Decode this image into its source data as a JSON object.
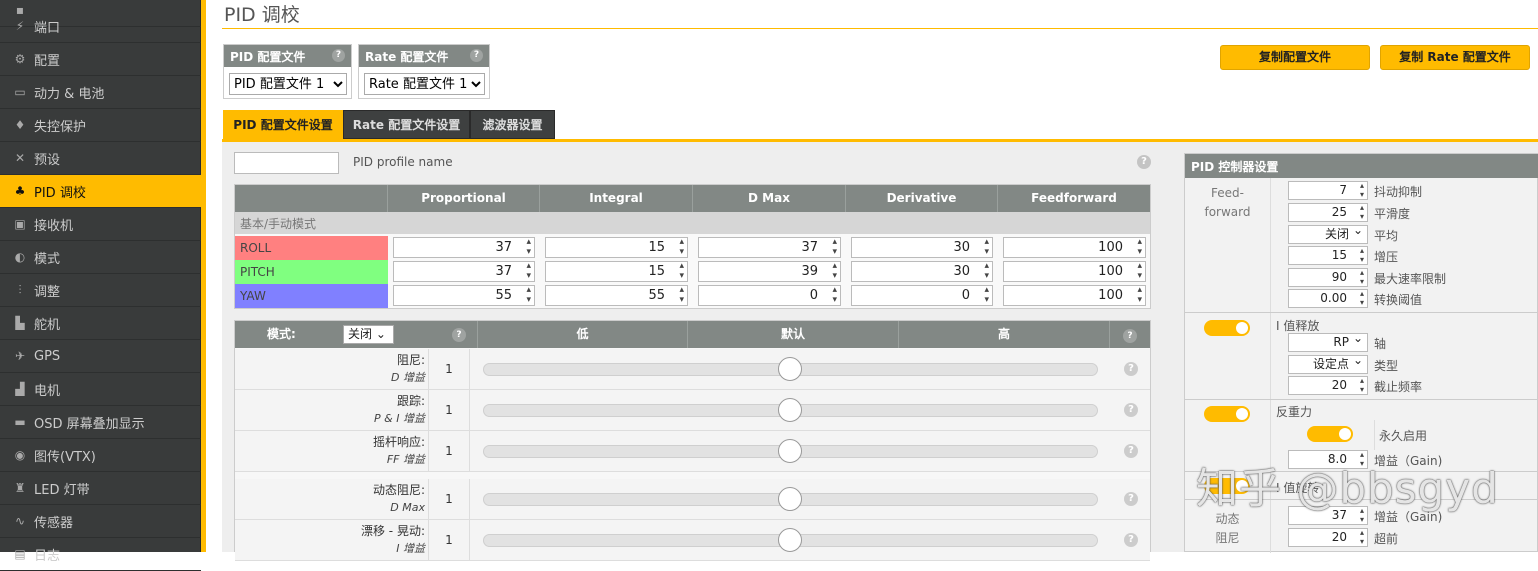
{
  "sidebar": {
    "items": [
      {
        "label": "端口",
        "icon": "plug-icon"
      },
      {
        "label": "配置",
        "icon": "gear-icon"
      },
      {
        "label": "动力 & 电池",
        "icon": "battery-icon"
      },
      {
        "label": "失控保护",
        "icon": "parachute-icon"
      },
      {
        "label": "预设",
        "icon": "wand-icon"
      },
      {
        "label": "PID 调校",
        "icon": "sitemap-icon",
        "active": true
      },
      {
        "label": "接收机",
        "icon": "receiver-icon"
      },
      {
        "label": "模式",
        "icon": "switch-icon"
      },
      {
        "label": "调整",
        "icon": "sliders-icon"
      },
      {
        "label": "舵机",
        "icon": "servo-icon"
      },
      {
        "label": "GPS",
        "icon": "satellite-icon"
      },
      {
        "label": "电机",
        "icon": "motor-icon"
      },
      {
        "label": "OSD 屏幕叠加显示",
        "icon": "osd-icon"
      },
      {
        "label": "图传(VTX)",
        "icon": "broadcast-icon"
      },
      {
        "label": "LED 灯带",
        "icon": "led-icon"
      },
      {
        "label": "传感器",
        "icon": "pulse-icon"
      },
      {
        "label": "日志",
        "icon": "log-icon"
      }
    ]
  },
  "header": {
    "title": "PID 调校"
  },
  "profiles": {
    "pid": {
      "title": "PID 配置文件",
      "selected": "PID 配置文件 1"
    },
    "rate": {
      "title": "Rate 配置文件",
      "selected": "Rate 配置文件 1"
    },
    "copy_pid": "复制配置文件",
    "copy_rate": "复制 Rate 配置文件"
  },
  "tabs": [
    "PID 配置文件设置",
    "Rate 配置文件设置",
    "滤波器设置"
  ],
  "profile_name_label": "PID profile name",
  "pid_table": {
    "columns": [
      "Proportional",
      "Integral",
      "D Max",
      "Derivative",
      "Feedforward"
    ],
    "section": "基本/手动模式",
    "rows": [
      {
        "axis": "ROLL",
        "color": "#ff8080",
        "values": [
          "37",
          "15",
          "37",
          "30",
          "100"
        ]
      },
      {
        "axis": "PITCH",
        "color": "#80ff80",
        "values": [
          "37",
          "15",
          "39",
          "30",
          "100"
        ]
      },
      {
        "axis": "YAW",
        "color": "#8080ff",
        "values": [
          "55",
          "55",
          "0",
          "0",
          "100"
        ]
      }
    ]
  },
  "sliders": {
    "mode_label": "模式:",
    "mode_value": "关闭",
    "low": "低",
    "default": "默认",
    "high": "高",
    "rows": [
      {
        "label": "阻尼:",
        "sub": "D 增益",
        "value": "1"
      },
      {
        "label": "跟踪:",
        "sub": "P & I 增益",
        "value": "1"
      },
      {
        "label": "摇杆响应:",
        "sub": "FF 增益",
        "value": "1"
      },
      {
        "label": "动态阻尼:",
        "sub": "D Max",
        "value": "1"
      },
      {
        "label": "漂移 - 晃动:",
        "sub": "I 增益",
        "value": "1"
      }
    ]
  },
  "controller": {
    "title": "PID 控制器设置",
    "ff_label": "Feed-forward",
    "ff": [
      {
        "value": "7",
        "label": "抖动抑制"
      },
      {
        "value": "25",
        "label": "平滑度"
      },
      {
        "value": "关闭",
        "label": "平均",
        "select": true
      },
      {
        "value": "15",
        "label": "增压"
      },
      {
        "value": "90",
        "label": "最大速率限制"
      },
      {
        "value": "0.00",
        "label": "转换阈值"
      }
    ],
    "iterm_relax": {
      "title": "I 值释放",
      "axis": "RP",
      "axis_label": "轴",
      "type": "设定点",
      "type_label": "类型",
      "cutoff": "20",
      "cutoff_label": "截止频率"
    },
    "anti_gravity": {
      "title": "反重力",
      "always": "永久启用",
      "gain": "8.0",
      "gain_label": "增益（Gain)"
    },
    "i_rotation": "I 值旋转",
    "dyn_damping": {
      "label": "动态阻尼",
      "gain": "37",
      "gain_label": "增益（Gain)",
      "advance": "20",
      "advance_label": "超前"
    }
  },
  "watermark": "知乎 @bbsgyd",
  "colors": {
    "accent": "#ffbb00",
    "sidebar": "#393b3b",
    "header": "#828885"
  }
}
